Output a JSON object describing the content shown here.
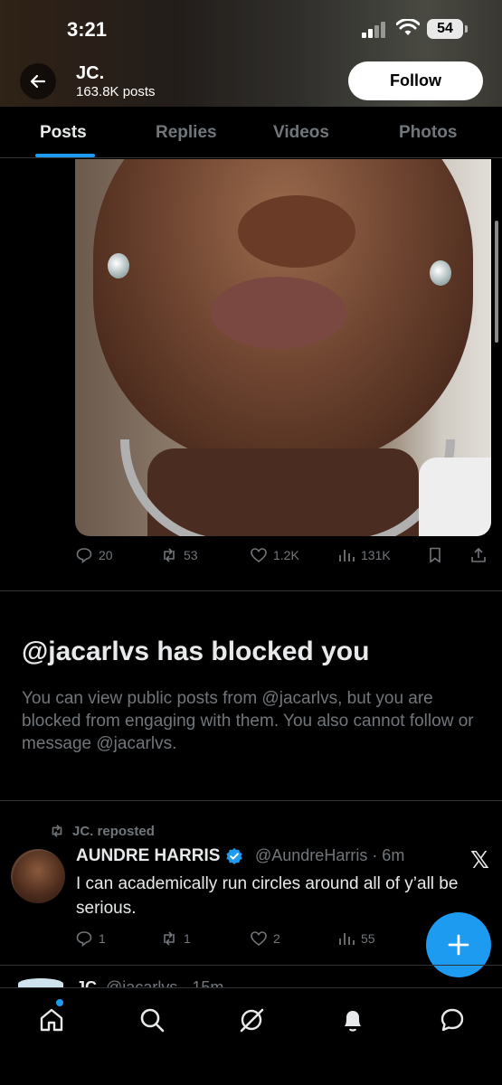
{
  "status_bar": {
    "time": "3:21",
    "battery": "54"
  },
  "profile": {
    "name": "JC.",
    "post_count": "163.8K posts",
    "follow_label": "Follow"
  },
  "tabs": [
    {
      "label": "Posts",
      "active": true
    },
    {
      "label": "Replies",
      "active": false
    },
    {
      "label": "Videos",
      "active": false
    },
    {
      "label": "Photos",
      "active": false
    }
  ],
  "first_post": {
    "replies": "20",
    "reposts": "53",
    "likes": "1.2K",
    "views": "131K"
  },
  "blocked": {
    "title": "@jacarlvs has blocked you",
    "text": "You can view public posts from @jacarlvs, but you are blocked from engaging with them. You also cannot follow or message @jacarlvs."
  },
  "repost": {
    "repost_label": "JC. reposted",
    "author_name": "AUNDRE HARRIS",
    "author_handle": "@AundreHarris · 6m",
    "text": "I can academically run circles around all of y’all be serious.",
    "replies": "1",
    "reposts": "1",
    "likes": "2",
    "views": "55"
  },
  "next_post": {
    "name": "JC.",
    "handle": "@jacarlvs · 15m"
  },
  "colors": {
    "accent": "#1d9bf0",
    "background": "#000000",
    "muted": "#71767b"
  },
  "nav": [
    "home-icon",
    "search-icon",
    "grok-icon",
    "notifications-icon",
    "messages-icon"
  ]
}
